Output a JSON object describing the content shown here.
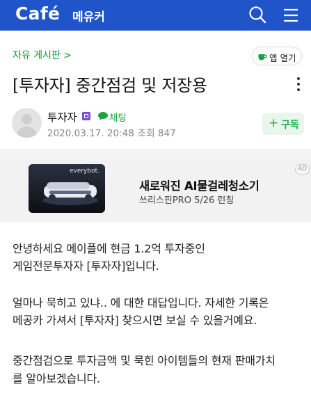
{
  "header": {
    "logo": "Café",
    "app_name": "메유커",
    "search_icon": "search-icon",
    "menu_icon": "menu-icon",
    "background": "#1f55c9"
  },
  "board": {
    "label": "자유 게시판 >",
    "color": "#0f9b33"
  },
  "app_open": {
    "label": "앱 열기",
    "icon": "coffee-cup-icon"
  },
  "post": {
    "title": "[투자자] 중간점검 및 저장용",
    "author": "투자자",
    "level_icon": "level-badge-icon",
    "chat_label": "채팅",
    "date": "2020.03.17. 20:48",
    "views": "조회 847",
    "subscribe_plus": "+",
    "subscribe_label": "구독",
    "accent": "#1aa84a"
  },
  "ad": {
    "brand": "everybot.",
    "headline": "새로워진 AI물걸레청소기",
    "sub": "쓰리스핀PRO 5/26 런칭",
    "badge": "AD"
  },
  "content": {
    "line1": "안녕하세요 메이플에 현금 1.2억 투자중인",
    "line2": "게임전문투자자 [투자자]입니다.",
    "line3": "얼마나 묵히고 있냐.. 에 대한 대답입니다. 자세한 기록은",
    "line4": "메공카 가셔서 [투자자] 찾으시면 보실 수 있을거예요.",
    "line5": "중간점검으로 투자금액 및 묵힌 아이템들의 현재 판매가치",
    "line6": "를 알아보겠습니다."
  }
}
